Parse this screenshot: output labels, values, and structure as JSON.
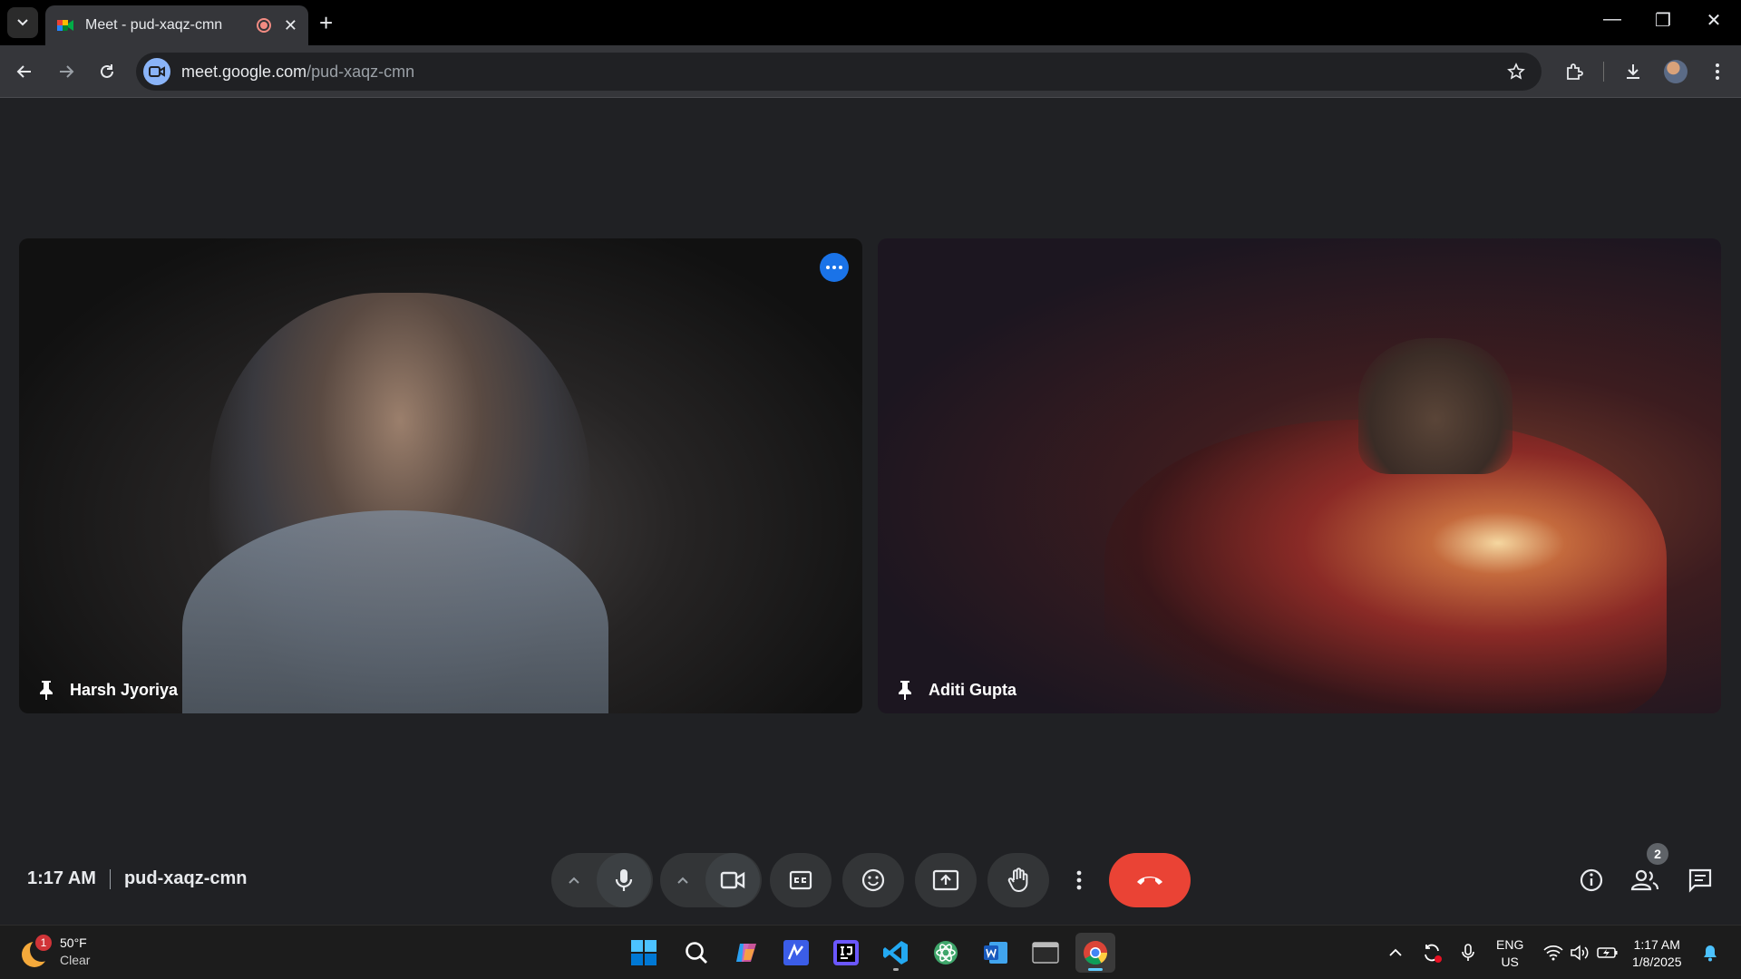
{
  "browser": {
    "tab_title": "Meet - pud-xaqz-cmn",
    "url_host": "meet.google.com",
    "url_path": "/pud-xaqz-cmn"
  },
  "participants": [
    {
      "name": "Harsh Jyoriya"
    },
    {
      "name": "Aditi Gupta"
    }
  ],
  "meeting": {
    "time": "1:17 AM",
    "code": "pud-xaqz-cmn",
    "participant_count": "2"
  },
  "taskbar": {
    "weather": {
      "badge": "1",
      "temp": "50°F",
      "condition": "Clear"
    },
    "language": {
      "line1": "ENG",
      "line2": "US"
    },
    "clock": {
      "time": "1:17 AM",
      "date": "1/8/2025"
    }
  },
  "colors": {
    "hangup": "#ea4335",
    "accent": "#1a73e8",
    "meet_bg": "#202124"
  }
}
